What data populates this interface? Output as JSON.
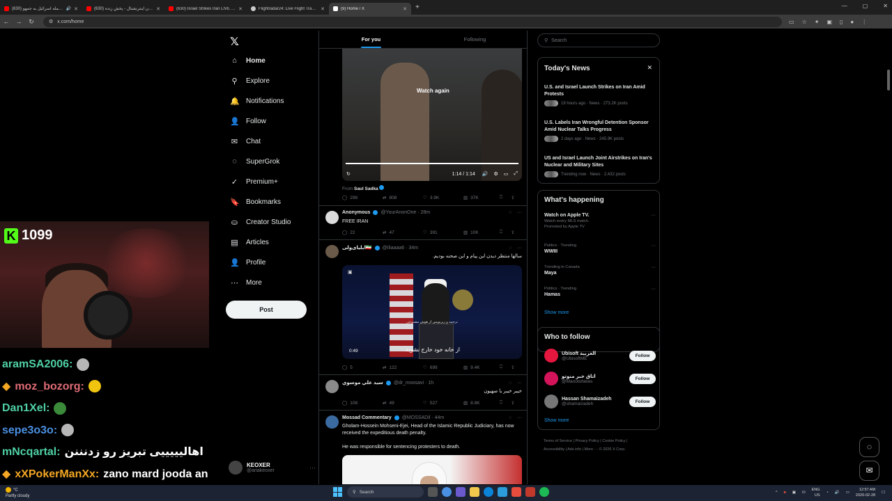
{
  "browser": {
    "tabs": [
      {
        "title": "(630) حمله اسرائیل به جمهو...",
        "color": "#ff0000"
      },
      {
        "title": "(630) ایران اینترنشنال - پخش زنده",
        "color": "#ff0000"
      },
      {
        "title": "(630) Israel Strikes Iran LIVE | Ea",
        "color": "#ff0000"
      },
      {
        "title": "Flightradar24: Live Flight Tracke",
        "color": "#cccccc"
      },
      {
        "title": "(9) Home / X",
        "color": "#ffffff"
      }
    ],
    "url": "x.com/home"
  },
  "stream": {
    "viewer_count": "1099",
    "chat": [
      {
        "user": "aramSA2006:",
        "text": "",
        "color": "#4fd1a5",
        "badge": false
      },
      {
        "user": "moz_bozorg:",
        "text": "",
        "color": "#e06c75",
        "badge": true
      },
      {
        "user": "Dan1Xel:",
        "text": "",
        "color": "#4fd1a5",
        "badge": false
      },
      {
        "user": "sepe3o3o:",
        "text": "",
        "color": "#4a90e2",
        "badge": false
      },
      {
        "user": "mNcqartal:",
        "text": "اهالیییییی تبریز رو زدنننن",
        "color": "#4fd1a5",
        "badge": false
      },
      {
        "user": "xXPokerManXx:",
        "text": "zano mard jooda an",
        "color": "#f5a623",
        "badge": true
      }
    ]
  },
  "sidebar": {
    "items": [
      {
        "label": "Home",
        "icon": "⌂"
      },
      {
        "label": "Explore",
        "icon": "⚲"
      },
      {
        "label": "Notifications",
        "icon": "🔔"
      },
      {
        "label": "Follow",
        "icon": "👤"
      },
      {
        "label": "Chat",
        "icon": "✉"
      },
      {
        "label": "SuperGrok",
        "icon": "◌"
      },
      {
        "label": "Premium+",
        "icon": "✓"
      },
      {
        "label": "Bookmarks",
        "icon": "🔖"
      },
      {
        "label": "Creator Studio",
        "icon": "⛀"
      },
      {
        "label": "Articles",
        "icon": "▤"
      },
      {
        "label": "Profile",
        "icon": "👤"
      },
      {
        "label": "More",
        "icon": "⋯"
      }
    ],
    "post_label": "Post",
    "account": {
      "name": "KEOXER",
      "handle": "@ariakeoxer"
    }
  },
  "timeline": {
    "tabs": [
      "For you",
      "Following"
    ],
    "video1": {
      "overlay": "Watch again",
      "time": "1:14 / 1:14"
    },
    "from_prefix": "From",
    "from_name": "Saul Sadka",
    "tweet1_stats": [
      "298",
      "808",
      "3.9K",
      "37K"
    ],
    "tweet2": {
      "name": "Anonymous",
      "handle": "@YourAnonOne · 28m",
      "text": "FREE IRAN",
      "stats": [
        "22",
        "47",
        "391",
        "10K"
      ]
    },
    "tweet3": {
      "name": "ایلیای‌ولی🇮🇷",
      "handle": "@Iliaaaa6 · 34m",
      "text": "سالها منتظر دیدن این پیام و این صحنه بودیم.",
      "subtitle_small": "ترجمه و زیرنویس از هوش مصنوعی",
      "subtitle": "از خانه خود خارج نشوید.",
      "duration": "0:49",
      "stats": [
        "5",
        "122",
        "699",
        "9.4K"
      ]
    },
    "tweet4": {
      "name": "سيد علي موسوي",
      "handle": "@dr_moosavi · 1h",
      "text": "خيبر خيبر يا صهيون",
      "stats": [
        "108",
        "49",
        "527",
        "8.8K"
      ]
    },
    "tweet5": {
      "name": "Mossad Commentary",
      "handle": "@MOSSADil · 44m",
      "text1": "Gholam-Hossein Mohseni-Ejei, Head of the Islamic Republic Judiciary, has now received the expeditious death penalty.",
      "text2": "He was responsible for sentencing protesters to death."
    }
  },
  "right": {
    "search_placeholder": "Search",
    "news_title": "Today's News",
    "news": [
      {
        "title": "U.S. and Israel Launch Strikes on Iran Amid Protests",
        "meta": "19 hours ago · News · 273.2K posts"
      },
      {
        "title": "U.S. Labels Iran Wrongful Detention Sponsor Amid Nuclear Talks Progress",
        "meta": "2 days ago · News · 245.9K posts"
      },
      {
        "title": "US and Israel Launch Joint Airstrikes on Iran's Nuclear and Military Sites",
        "meta": "Trending now · News · 2,432 posts"
      }
    ],
    "happening_title": "What's happening",
    "promo": {
      "title": "Watch on Apple TV.",
      "sub": "Watch every MLS match.",
      "meta": "Promoted by Apple TV"
    },
    "trends": [
      {
        "meta": "Politics · Trending",
        "title": "WWIII"
      },
      {
        "meta": "Trending in Canada",
        "title": "Maya"
      },
      {
        "meta": "Politics · Trending",
        "title": "Hamas"
      }
    ],
    "show_more": "Show more",
    "wtf_title": "Who to follow",
    "wtf": [
      {
        "name": "Ubisoft العربية",
        "handle": "@UbisoftME",
        "color": "#e5173f"
      },
      {
        "name": "اتاق خبر منوتو",
        "handle": "@ManotoNews",
        "color": "#d4145a"
      },
      {
        "name": "Hassan Shamaizadeh",
        "handle": "@shamaizadeh",
        "color": "#777777"
      }
    ],
    "follow_label": "Follow",
    "footer": [
      "Terms of Service",
      "Privacy Policy",
      "Cookie Policy",
      "Accessibility",
      "Ads info",
      "More ···",
      "© 2026 X Corp."
    ]
  },
  "taskbar": {
    "weather_temp": "°C",
    "weather_text": "Partly cloudy",
    "search": "Search",
    "lang": "ENG",
    "region": "US",
    "time": "12:57 AM",
    "date": "2026-02-28"
  }
}
